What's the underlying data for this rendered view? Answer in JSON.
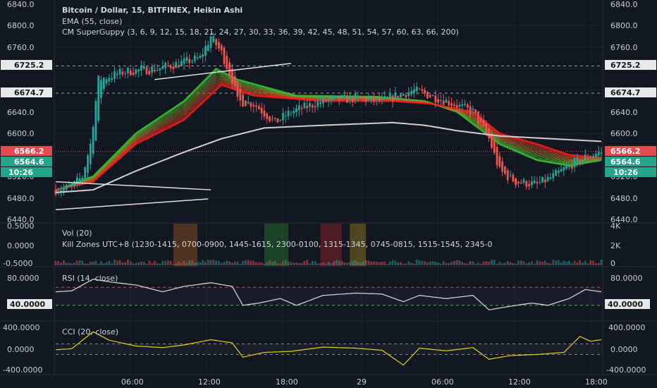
{
  "legend": {
    "main_title": "Bitcoin / Dollar, 15, BITFINEX, Heikin Ashi",
    "ema": "EMA (55, close)",
    "superguppy": "CM SuperGuppy (3, 6, 9, 12, 15, 18, 21, 24, 27, 30, 33, 36, 39, 42, 45, 48, 51, 54, 57, 60, 63, 66, 200)",
    "vol": "Vol (20)",
    "killzones": "Kill Zones UTC+8 (1230-1415, 0700-0900, 1445-1615, 2300-0100, 1315-1345, 0745-0815, 1515-1545, 2345-0",
    "rsi": "RSI (14, close)",
    "cci": "CCI (20, close)"
  },
  "colors": {
    "background": "#131722",
    "up": "#26a69a",
    "down": "#ef5350",
    "ema": "#cfcfcf",
    "guppy_red": "#ff1a1a",
    "guppy_green": "#33cc33",
    "rsi_line": "#d0d0d0",
    "cci_line": "#e0d418",
    "red_label": "#e54a4f",
    "green_label": "#22a68a"
  },
  "axes": {
    "price_ticks": [
      "6840.0",
      "6800.0",
      "6760.0",
      "6725.2",
      "6674.7",
      "6640.0",
      "6600.0",
      "6566.2",
      "6564.6",
      "10:26",
      "6520.0",
      "6480.0",
      "6440.0"
    ],
    "vol_left_ticks": [
      "0.5000",
      "0.0000",
      "-0.5000"
    ],
    "vol_right_ticks": [
      "4K",
      "2K",
      "0"
    ],
    "rsi_ticks": [
      "80.0000",
      "40.0000"
    ],
    "cci_ticks": [
      "400.0000",
      "0.0000",
      "-400.0000"
    ],
    "time_ticks": [
      "06:00",
      "12:00",
      "18:00",
      "29",
      "06:00",
      "12:00",
      "18:00"
    ]
  },
  "price_labels": {
    "level_high": "6725.2",
    "level_mid": "6674.7",
    "current": "6566.2",
    "green": "6564.6",
    "countdown": "10:26"
  },
  "rsi_value": "40.0000",
  "chart_data": {
    "type": "candlestick",
    "title": "Bitcoin / Dollar, 15, BITFINEX, Heikin Ashi",
    "ylim": [
      6440,
      6840
    ],
    "price_levels": [
      6725.2,
      6674.7,
      6566.2
    ],
    "rsi_levels": [
      70,
      30
    ],
    "cci_levels": [
      100,
      -100
    ],
    "price_anchors": [
      [
        0,
        6495
      ],
      [
        6,
        6500
      ],
      [
        10,
        6520
      ],
      [
        13,
        6580
      ],
      [
        16,
        6700
      ],
      [
        26,
        6715
      ],
      [
        38,
        6720
      ],
      [
        54,
        6740
      ],
      [
        58,
        6780
      ],
      [
        62,
        6750
      ],
      [
        66,
        6700
      ],
      [
        68,
        6660
      ],
      [
        74,
        6655
      ],
      [
        82,
        6620
      ],
      [
        88,
        6640
      ],
      [
        100,
        6660
      ],
      [
        112,
        6665
      ],
      [
        122,
        6660
      ],
      [
        134,
        6680
      ],
      [
        146,
        6660
      ],
      [
        156,
        6640
      ],
      [
        162,
        6590
      ],
      [
        166,
        6530
      ],
      [
        172,
        6510
      ],
      [
        180,
        6505
      ],
      [
        186,
        6520
      ],
      [
        192,
        6540
      ],
      [
        198,
        6555
      ],
      [
        204,
        6565
      ]
    ],
    "ema55": [
      [
        0,
        6490
      ],
      [
        14,
        6495
      ],
      [
        30,
        6530
      ],
      [
        48,
        6565
      ],
      [
        62,
        6590
      ],
      [
        78,
        6610
      ],
      [
        100,
        6615
      ],
      [
        126,
        6620
      ],
      [
        138,
        6615
      ],
      [
        150,
        6605
      ],
      [
        166,
        6595
      ],
      [
        185,
        6590
      ],
      [
        204,
        6585
      ]
    ],
    "guppy_red": [
      [
        0,
        6495
      ],
      [
        14,
        6510
      ],
      [
        30,
        6580
      ],
      [
        48,
        6625
      ],
      [
        62,
        6690
      ],
      [
        74,
        6670
      ],
      [
        100,
        6660
      ],
      [
        126,
        6660
      ],
      [
        140,
        6655
      ],
      [
        156,
        6640
      ],
      [
        166,
        6600
      ],
      [
        180,
        6580
      ],
      [
        192,
        6560
      ],
      [
        204,
        6555
      ]
    ],
    "guppy_green": [
      [
        0,
        6493
      ],
      [
        14,
        6520
      ],
      [
        30,
        6600
      ],
      [
        48,
        6660
      ],
      [
        60,
        6720
      ],
      [
        68,
        6700
      ],
      [
        90,
        6670
      ],
      [
        120,
        6668
      ],
      [
        138,
        6660
      ],
      [
        150,
        6640
      ],
      [
        166,
        6580
      ],
      [
        180,
        6550
      ],
      [
        192,
        6540
      ],
      [
        204,
        6550
      ]
    ],
    "trendlines": [
      {
        "from": [
          37,
          6700
        ],
        "to": [
          88,
          6730
        ]
      },
      {
        "from": [
          0,
          6510
        ],
        "to": [
          58,
          6495
        ]
      },
      {
        "from": [
          0,
          6458
        ],
        "to": [
          57,
          6478
        ]
      }
    ],
    "rsi_anchors": [
      [
        0,
        60
      ],
      [
        6,
        62
      ],
      [
        14,
        88
      ],
      [
        20,
        82
      ],
      [
        30,
        75
      ],
      [
        40,
        60
      ],
      [
        48,
        72
      ],
      [
        58,
        80
      ],
      [
        66,
        72
      ],
      [
        70,
        30
      ],
      [
        76,
        35
      ],
      [
        84,
        45
      ],
      [
        90,
        30
      ],
      [
        100,
        52
      ],
      [
        112,
        57
      ],
      [
        122,
        55
      ],
      [
        130,
        38
      ],
      [
        136,
        52
      ],
      [
        146,
        45
      ],
      [
        156,
        52
      ],
      [
        162,
        20
      ],
      [
        170,
        28
      ],
      [
        178,
        35
      ],
      [
        184,
        30
      ],
      [
        192,
        45
      ],
      [
        198,
        65
      ],
      [
        204,
        60
      ]
    ],
    "cci_anchors": [
      [
        0,
        -10
      ],
      [
        6,
        10
      ],
      [
        14,
        330
      ],
      [
        20,
        170
      ],
      [
        30,
        60
      ],
      [
        40,
        30
      ],
      [
        48,
        80
      ],
      [
        58,
        180
      ],
      [
        66,
        120
      ],
      [
        70,
        -150
      ],
      [
        78,
        -60
      ],
      [
        88,
        -40
      ],
      [
        100,
        40
      ],
      [
        112,
        20
      ],
      [
        122,
        -20
      ],
      [
        130,
        -300
      ],
      [
        136,
        20
      ],
      [
        146,
        -30
      ],
      [
        156,
        30
      ],
      [
        162,
        -190
      ],
      [
        170,
        -120
      ],
      [
        180,
        -100
      ],
      [
        190,
        -60
      ],
      [
        196,
        240
      ],
      [
        200,
        150
      ],
      [
        204,
        180
      ]
    ],
    "kill_zones": [
      {
        "from": 44,
        "to": 53,
        "color": "#ff8a1f"
      },
      {
        "from": 78,
        "to": 87,
        "color": "#33cc33"
      },
      {
        "from": 99,
        "to": 107,
        "color": "#ff2b2b"
      },
      {
        "from": 110,
        "to": 116,
        "color": "#ffd21f"
      }
    ]
  }
}
